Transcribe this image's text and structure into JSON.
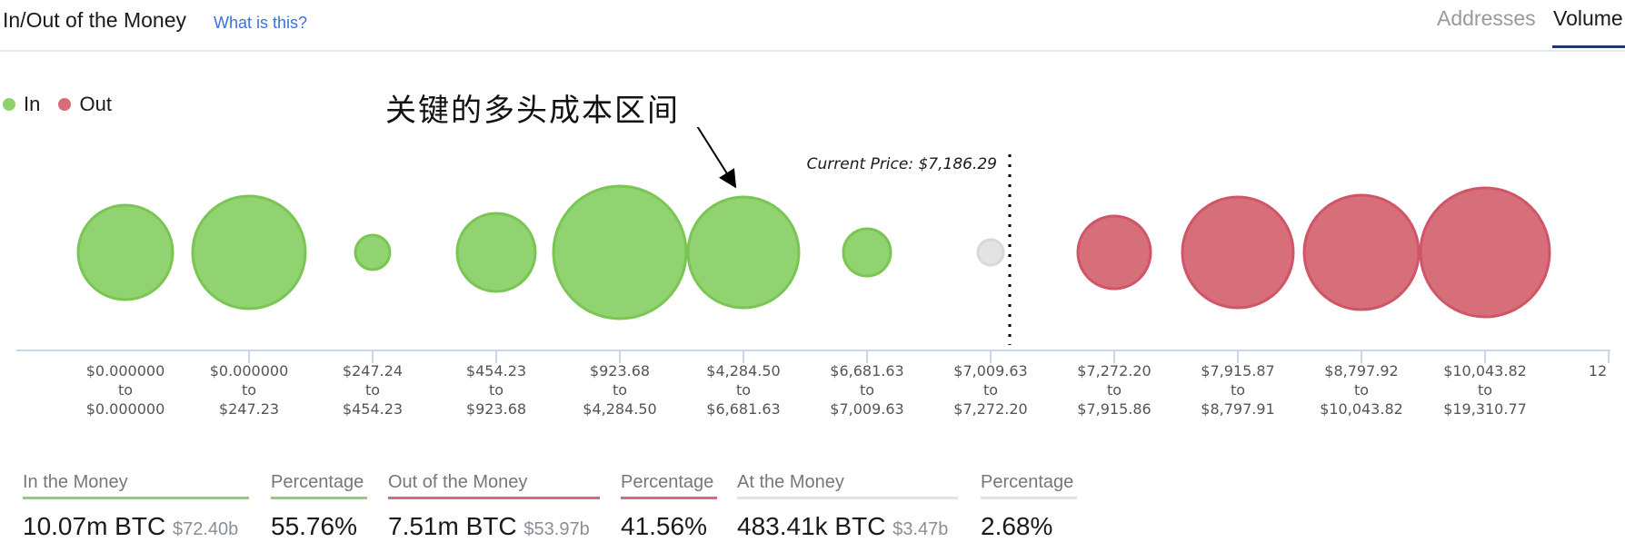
{
  "header": {
    "title": "In/Out of the Money",
    "help_link": "What is this?",
    "tabs": [
      {
        "label": "Addresses",
        "active": false
      },
      {
        "label": "Volume",
        "active": true
      }
    ]
  },
  "legend": [
    {
      "label": "In",
      "color": "#8fd16e"
    },
    {
      "label": "Out",
      "color": "#d66c78"
    }
  ],
  "annotation": {
    "text": "关键的多头成本区间"
  },
  "colors": {
    "in_fill": "#8fd16e",
    "in_stroke": "#79c653",
    "out_fill": "#d66c78",
    "out_stroke": "#cf5567",
    "at_fill": "#e2e2e2",
    "at_stroke": "#d8d8d8",
    "axis": "#c8d6ea",
    "tab_active": "#23356e",
    "link": "#3d6fe0"
  },
  "chart_data": {
    "type": "bubble",
    "title": "In/Out of the Money",
    "current_price_label": "Current Price: $7,186.29",
    "current_price": 7186.29,
    "note": "bubble size = relative volume (estimated from rendered size)",
    "buckets": [
      {
        "from": "$0.000000",
        "to": "$0.000000",
        "status": "in",
        "relative_size": 0.52
      },
      {
        "from": "$0.000000",
        "to": "$247.23",
        "status": "in",
        "relative_size": 0.62
      },
      {
        "from": "$247.24",
        "to": "$454.23",
        "status": "in",
        "relative_size": 0.19
      },
      {
        "from": "$454.23",
        "to": "$923.68",
        "status": "in",
        "relative_size": 0.43
      },
      {
        "from": "$923.68",
        "to": "$4,284.50",
        "status": "in",
        "relative_size": 0.73
      },
      {
        "from": "$4,284.50",
        "to": "$6,681.63",
        "status": "in",
        "relative_size": 0.61
      },
      {
        "from": "$6,681.63",
        "to": "$7,009.63",
        "status": "in",
        "relative_size": 0.26
      },
      {
        "from": "$7,009.63",
        "to": "$7,272.20",
        "status": "at",
        "relative_size": 0.14
      },
      {
        "from": "$7,272.20",
        "to": "$7,915.86",
        "status": "out",
        "relative_size": 0.4
      },
      {
        "from": "$7,915.87",
        "to": "$8,797.91",
        "status": "out",
        "relative_size": 0.61
      },
      {
        "from": "$8,797.92",
        "to": "$10,043.82",
        "status": "out",
        "relative_size": 0.63
      },
      {
        "from": "$10,043.82",
        "to": "$19,310.77",
        "status": "out",
        "relative_size": 0.71
      }
    ],
    "connector": "to",
    "partial_tick_label": "12"
  },
  "stats": [
    {
      "label": "In the Money",
      "value": "10.07m BTC",
      "sub": "$72.40b",
      "color": "#8fd16e"
    },
    {
      "label": "Percentage",
      "value": "55.76%",
      "sub": "",
      "color": "#8fd16e"
    },
    {
      "label": "Out of the Money",
      "value": "7.51m BTC",
      "sub": "$53.97b",
      "color": "#d66c78"
    },
    {
      "label": "Percentage",
      "value": "41.56%",
      "sub": "",
      "color": "#d66c78"
    },
    {
      "label": "At the Money",
      "value": "483.41k BTC",
      "sub": "$3.47b",
      "color": "#e2e2e2"
    },
    {
      "label": "Percentage",
      "value": "2.68%",
      "sub": "",
      "color": "#e2e2e2"
    }
  ]
}
